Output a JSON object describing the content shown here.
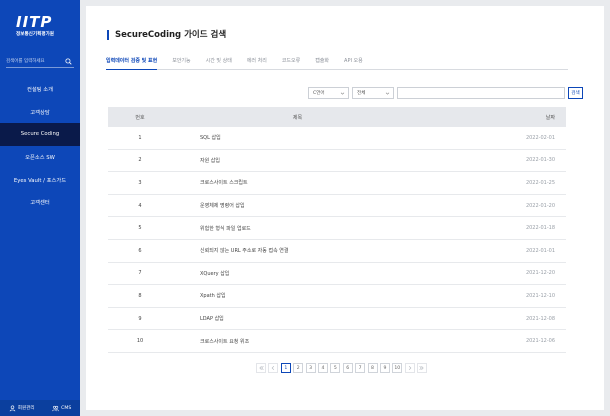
{
  "sidebar": {
    "logo_mark": "IITP",
    "logo_sub": "정보통신기획평가원",
    "search_placeholder": "검색어를 입력하세요",
    "items": [
      {
        "label": "컨설팅 소개"
      },
      {
        "label": "고객상담"
      },
      {
        "label": "Secure Coding"
      },
      {
        "label": "오픈소스 SW"
      },
      {
        "label": "Eyes Vault / 포스가드"
      },
      {
        "label": "고객센터"
      }
    ],
    "active_index": 2,
    "bottom": {
      "member_label": "회원관리",
      "cms_label": "CMS"
    }
  },
  "main": {
    "title": "SecureCoding 가이드 검색",
    "tabs": [
      {
        "label": "입력데이터 검증 및 표현"
      },
      {
        "label": "보안기능"
      },
      {
        "label": "시간 및 상태"
      },
      {
        "label": "에러 처리"
      },
      {
        "label": "코드오류"
      },
      {
        "label": "캡슐화"
      },
      {
        "label": "API 오용"
      }
    ],
    "active_tab": 0,
    "filters": {
      "language": "C언어",
      "scope": "전체",
      "search_placeholder": "",
      "search_button": "검색"
    },
    "table": {
      "headers": {
        "num": "번호",
        "title": "제목",
        "date": "날짜"
      },
      "rows": [
        {
          "num": "1",
          "title": "SQL 삽입",
          "date": "2022-02-01"
        },
        {
          "num": "2",
          "title": "자원 삽입",
          "date": "2022-01-30"
        },
        {
          "num": "3",
          "title": "크로스사이트 스크립트",
          "date": "2022-01-25"
        },
        {
          "num": "4",
          "title": "운영체제 명령어 삽입",
          "date": "2022-01-20"
        },
        {
          "num": "5",
          "title": "위험한 형식 파일 업로드",
          "date": "2022-01-18"
        },
        {
          "num": "6",
          "title": "신뢰되지 않는 URL 주소로 자동 접속 연결",
          "date": "2022-01-01"
        },
        {
          "num": "7",
          "title": "XQuery 삽입",
          "date": "2021-12-20"
        },
        {
          "num": "8",
          "title": "Xpath 삽입",
          "date": "2021-12-10"
        },
        {
          "num": "9",
          "title": "LDAP 삽입",
          "date": "2021-12-08"
        },
        {
          "num": "10",
          "title": "크로스사이트 요청 위조",
          "date": "2021-12-06"
        }
      ]
    },
    "pagination": {
      "pages": [
        "1",
        "2",
        "3",
        "4",
        "5",
        "6",
        "7",
        "8",
        "9",
        "10"
      ],
      "current": "1"
    }
  },
  "colors": {
    "brand": "#0d47b8",
    "sidebar_active": "#0a1a4a",
    "background": "#e9ebee"
  },
  "icons": {
    "search": "search-icon",
    "chevron": "chevron-down-icon",
    "first": "double-chevron-left-icon",
    "prev": "chevron-left-icon",
    "next": "chevron-right-icon",
    "last": "double-chevron-right-icon",
    "member": "user-icon",
    "cms": "users-icon"
  }
}
